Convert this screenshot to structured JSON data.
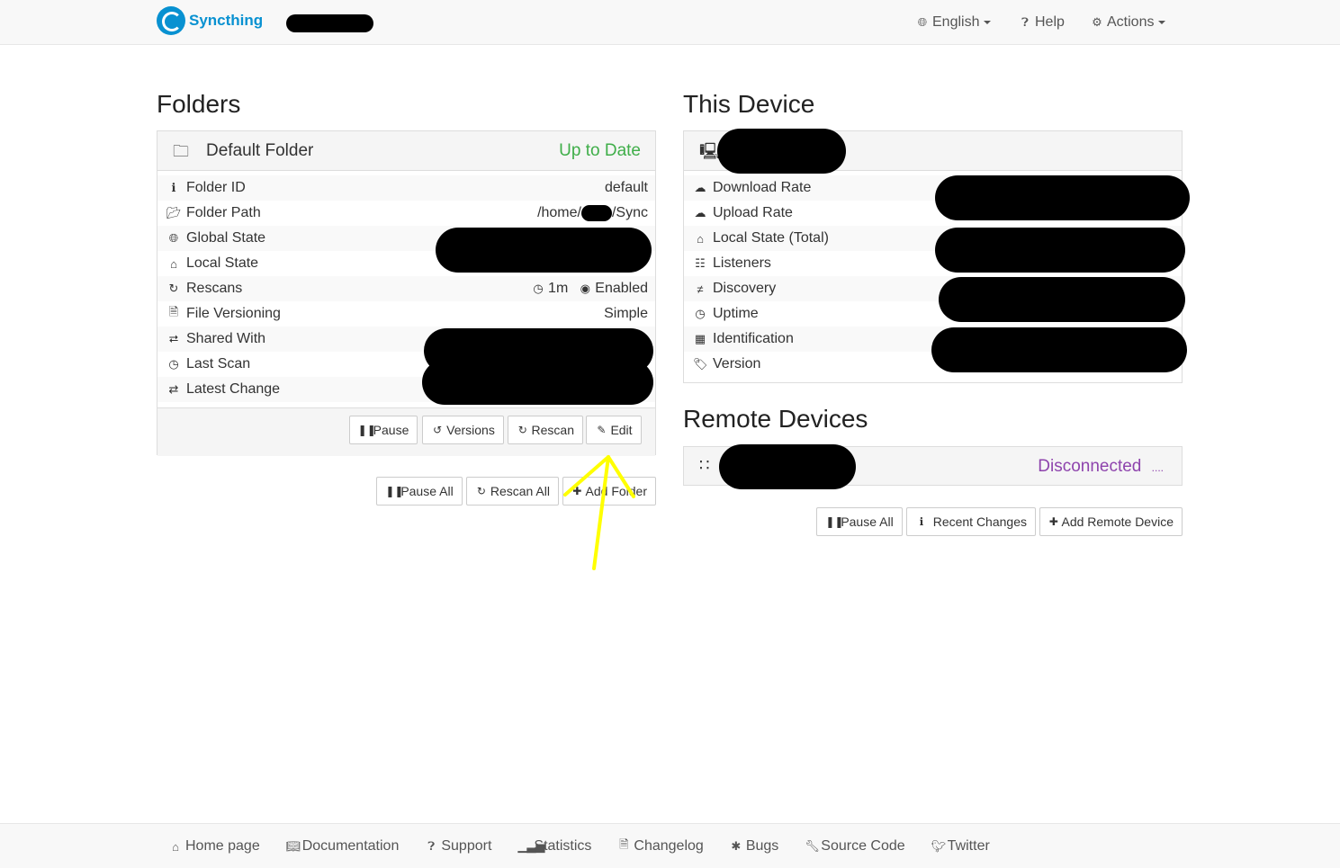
{
  "navbar": {
    "brand": "Syncthing",
    "language": "English",
    "help": "Help",
    "actions": "Actions"
  },
  "folders": {
    "heading": "Folders",
    "folder": {
      "name": "Default Folder",
      "status": "Up to Date",
      "rows": [
        {
          "label": "Folder ID",
          "value": "default"
        },
        {
          "label": "Folder Path",
          "value_prefix": "/home/",
          "value_suffix": "/Sync"
        },
        {
          "label": "Global State",
          "value": ""
        },
        {
          "label": "Local State",
          "value": ""
        },
        {
          "label": "Rescans",
          "value_interval": "1m",
          "value_watch": "Enabled"
        },
        {
          "label": "File Versioning",
          "value": "Simple"
        },
        {
          "label": "Shared With",
          "value": ""
        },
        {
          "label": "Last Scan",
          "value": ""
        },
        {
          "label": "Latest Change",
          "value": ""
        }
      ],
      "buttons": {
        "pause": "Pause",
        "versions": "Versions",
        "rescan": "Rescan",
        "edit": "Edit"
      }
    },
    "buttons": {
      "pause_all": "Pause All",
      "rescan_all": "Rescan All",
      "add_folder": "Add Folder"
    }
  },
  "this_device": {
    "heading": "This Device",
    "rows": [
      {
        "label": "Download Rate"
      },
      {
        "label": "Upload Rate"
      },
      {
        "label": "Local State (Total)"
      },
      {
        "label": "Listeners"
      },
      {
        "label": "Discovery"
      },
      {
        "label": "Uptime"
      },
      {
        "label": "Identification"
      },
      {
        "label": "Version"
      }
    ]
  },
  "remote_devices": {
    "heading": "Remote Devices",
    "device_status": "Disconnected",
    "device_status_suffix": "....",
    "buttons": {
      "pause_all": "Pause All",
      "recent_changes": "Recent Changes",
      "add_remote_device": "Add Remote Device"
    }
  },
  "footer": {
    "links": [
      "Home page",
      "Documentation",
      "Support",
      "Statistics",
      "Changelog",
      "Bugs",
      "Source Code",
      "Twitter"
    ]
  },
  "colors": {
    "brand": "#0891d1",
    "up_to_date": "#3fae49",
    "disconnected": "#8e44ad",
    "annotation_arrow": "#ffff00"
  }
}
